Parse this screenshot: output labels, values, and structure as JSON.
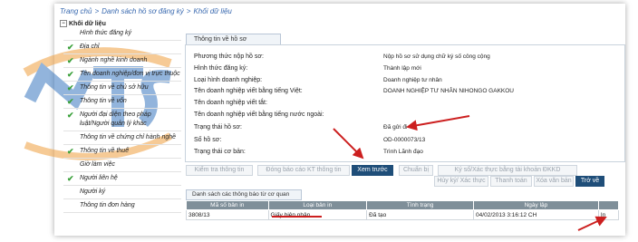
{
  "breadcrumb": [
    "Trang chủ",
    "Danh sách hồ sơ đăng ký",
    "Khối dữ liệu"
  ],
  "tree_root": "Khối dữ liệu",
  "sidebar": {
    "items": [
      {
        "label": "Hình thức đăng ký",
        "checked": false
      },
      {
        "label": "Địa chỉ",
        "checked": true
      },
      {
        "label": "Ngành nghề kinh doanh",
        "checked": true
      },
      {
        "label": "Tên doanh nghiệp/đơn vị trực thuộc",
        "checked": true
      },
      {
        "label": "Thông tin về chủ sở hữu",
        "checked": true
      },
      {
        "label": "Thông tin về vốn",
        "checked": true
      },
      {
        "label": "Người đại diện theo pháp luật/Người quản lý khác",
        "checked": true
      },
      {
        "label": "Thông tin về chứng chỉ hành nghề",
        "checked": false
      },
      {
        "label": "Thông tin về thuế",
        "checked": true
      },
      {
        "label": "Giờ làm việc",
        "checked": false
      },
      {
        "label": "Người liên hệ",
        "checked": true
      },
      {
        "label": "Người ký",
        "checked": false
      },
      {
        "label": "Thông tin đơn hàng",
        "checked": false
      }
    ]
  },
  "panel": {
    "tab": "Thông tin về hồ sơ",
    "fields": [
      {
        "label": "Phương thức nộp hồ sơ:",
        "value": "Nộp hồ sơ sử dụng chữ ký số công cộng"
      },
      {
        "label": "Hình thức đăng ký:",
        "value": "Thành lập mới"
      },
      {
        "label": "Loại hình doanh nghiệp:",
        "value": "Doanh nghiệp tư nhân"
      },
      {
        "label": "Tên doanh nghiệp viết bằng tiếng Việt:",
        "value": "DOANH NGHIỆP TƯ NHÂN NIHONGO GAKKOU"
      },
      {
        "label": "Tên doanh nghiệp viết tắt:",
        "value": ""
      },
      {
        "label": "Tên doanh nghiệp viết bằng tiếng nước ngoài:",
        "value": ""
      },
      {
        "label": "Trạng thái hồ sơ:",
        "value": "Đã gửi đi"
      },
      {
        "label": "Số hồ sơ:",
        "value": "OD-0000073/13"
      },
      {
        "label": "Trạng thái cơ bản:",
        "value": "Trình Lãnh đạo"
      }
    ]
  },
  "buttons": {
    "kiem_tra": "Kiểm tra thông tin",
    "dong_bao_cao": "Đóng báo cáo KT thông tin",
    "xem_truoc": "Xem trước",
    "chuan_bi": "Chuẩn bị",
    "ky_so": "Ký số/Xác thực bằng tài khoản ĐKKD",
    "huy_ky": "Hủy ký/ Xác thực",
    "thanh_toan": "Thanh toán",
    "xoa_van_ban": "Xóa văn bản",
    "tro_ve": "Trở về"
  },
  "notice_list": {
    "title": "Danh sách các thông báo từ cơ quan ĐKKD",
    "columns": [
      "Mã số bản in",
      "Loại bản in",
      "Tình trạng",
      "Ngày lập",
      ""
    ],
    "rows": [
      [
        "3808/13",
        "Giấy biên nhận",
        "Đã tạo",
        "04/02/2013 3:16:12 CH",
        "In"
      ]
    ]
  },
  "colors": {
    "accent": "#1f4e79",
    "check": "#3aa03a",
    "arrow": "#cc1f1f",
    "link": "#3a6ab0"
  }
}
